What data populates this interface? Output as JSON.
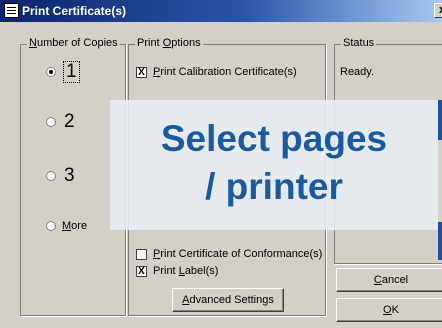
{
  "window": {
    "title": "Print Certificate(s)",
    "close_glyph": "x",
    "icon": "certificate-app-icon"
  },
  "copies": {
    "legend_pre": "",
    "legend_u": "N",
    "legend_post": "umber of Copies",
    "options": [
      {
        "label": "1",
        "selected": true
      },
      {
        "label": "2",
        "selected": false
      },
      {
        "label": "3",
        "selected": false
      }
    ],
    "more": {
      "u": "M",
      "rest": "ore",
      "selected": false
    }
  },
  "print_options": {
    "legend_pre": "Print ",
    "legend_u": "O",
    "legend_post": "ptions",
    "calibration": {
      "u": "P",
      "rest": "rint Calibration Certificate(s)",
      "checked": true
    },
    "conformance": {
      "u": "P",
      "rest": "rint Certificate of Conformance(s)",
      "checked": false
    },
    "label": {
      "pre": "Print ",
      "u": "L",
      "rest": "abel(s)",
      "checked": true
    },
    "advanced_button": {
      "pre": "",
      "u": "A",
      "rest": "dvanced Settings"
    },
    "check_mark": "X"
  },
  "status": {
    "legend": "Status",
    "text": "Ready."
  },
  "buttons": {
    "cancel": {
      "u": "C",
      "rest": "ancel"
    },
    "ok": {
      "u": "O",
      "rest": "K"
    }
  },
  "overlay": {
    "line1": "Select pages",
    "line2": "/ printer",
    "color": "#1c5a9e"
  }
}
